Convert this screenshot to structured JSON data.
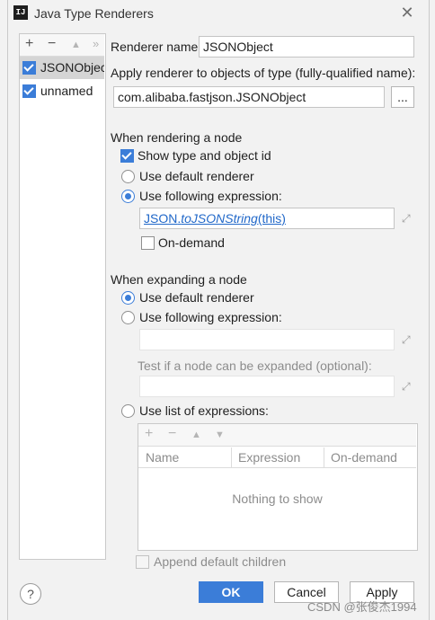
{
  "window": {
    "title": "Java Type Renderers",
    "app_icon_text": "IJ"
  },
  "renderer_list": {
    "toolbar": [
      "+",
      "−",
      "▲",
      "»"
    ],
    "items": [
      {
        "label": "JSONObject",
        "checked": true,
        "selected": true
      },
      {
        "label": "unnamed",
        "checked": true,
        "selected": false
      }
    ]
  },
  "form": {
    "renderer_name_label": "Renderer name:",
    "renderer_name_value": "JSONObject",
    "apply_label": "Apply renderer to objects of type (fully-qualified name):",
    "type_value": "com.alibaba.fastjson.JSONObject",
    "browse_button": "...",
    "rendering": {
      "heading": "When rendering a node",
      "show_type_label": "Show type and object id",
      "use_default_label": "Use default renderer",
      "use_expression_label": "Use following expression:",
      "expression": {
        "class_part": "JSON",
        "method_part": "toJSONString",
        "args_part": "(this)"
      },
      "on_demand_label": "On-demand"
    },
    "expanding": {
      "heading": "When expanding a node",
      "use_default_label": "Use default renderer",
      "use_expression_label": "Use following expression:",
      "test_label": "Test if a node can be expanded (optional):",
      "use_list_label": "Use list of expressions:",
      "table_toolbar": [
        "+",
        "−",
        "▲",
        "▼"
      ],
      "columns": [
        "Name",
        "Expression",
        "On-demand"
      ],
      "empty_text": "Nothing to show",
      "append_label": "Append default children"
    }
  },
  "buttons": {
    "ok": "OK",
    "cancel": "Cancel",
    "apply": "Apply",
    "help": "?"
  },
  "watermark": "CSDN @张俊杰1994",
  "colors": {
    "accent": "#3b7dd8",
    "link": "#2168c9",
    "background": "#f2f2f2"
  }
}
